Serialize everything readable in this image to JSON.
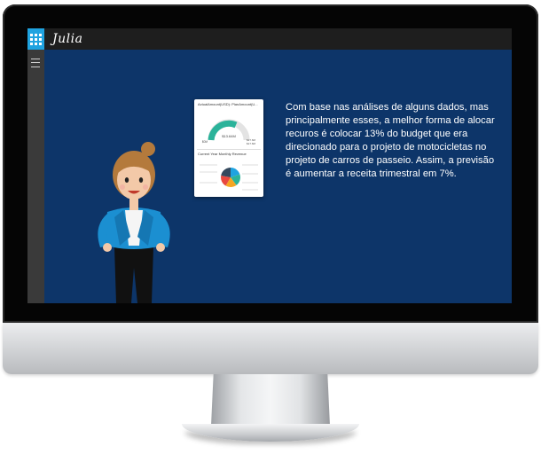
{
  "app": {
    "title": "Julia"
  },
  "dashboard_card": {
    "gauge_title": "ActualAmount(USD): PlanAmount(U...",
    "gauge_value": "$13.64M",
    "gauge_min": "$0M",
    "gauge_max_1": "$27.6M",
    "gauge_max_2": "$17.6M",
    "pie_title": "Current Year Monthly Revenue"
  },
  "narration": "Com base nas análises de alguns dados, mas principalmente esses, a melhor forma de alocar recuros é colocar 13% do budget que era direcionado para o projeto de motocicletas no projeto de carros de passeio. Assim, a previsão é aumentar a receita trimestral em 7%.",
  "colors": {
    "screen_bg": "#0d3569",
    "topbar_bg": "#1e1e1e",
    "logo_accent": "#1fa3e0",
    "gauge_fill": "#2bb39a"
  },
  "icons": {
    "logo": "grid-icon",
    "menu": "hamburger-menu-icon"
  }
}
